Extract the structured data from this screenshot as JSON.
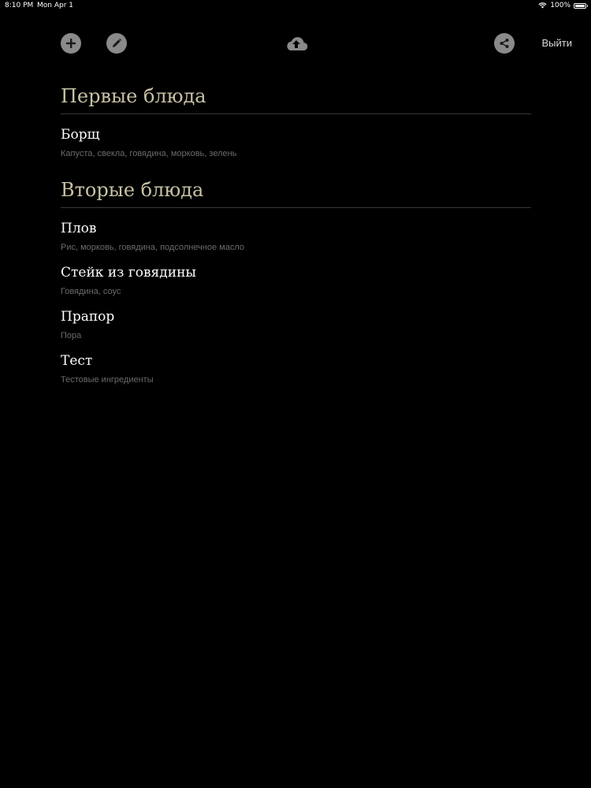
{
  "status_bar": {
    "time": "8:10 PM",
    "date": "Mon Apr 1",
    "battery": "100%",
    "battery_level": 1.0
  },
  "toolbar": {
    "logout_label": "Выйти",
    "icons": [
      "add-icon",
      "edit-icon",
      "cloud-upload-icon",
      "share-icon"
    ],
    "button_color": "#8a8a8a"
  },
  "sections": [
    {
      "title": "Первые блюда",
      "dishes": [
        {
          "name": "Борщ",
          "ingredients": "Капуста, свекла, говядина, морковь, зелень"
        }
      ]
    },
    {
      "title": "Вторые блюда",
      "dishes": [
        {
          "name": "Плов",
          "ingredients": "Рис, морковь, говядина, подсолнечное масло"
        },
        {
          "name": "Стейк из говядины",
          "ingredients": "Говядина, соус"
        },
        {
          "name": "Прапор",
          "ingredients": "Пора"
        },
        {
          "name": "Тест",
          "ingredients": "Тестовые ингредиенты"
        }
      ]
    }
  ],
  "colors": {
    "background": "#000000",
    "section_title": "#c9c2a4",
    "dish_name": "#ffffff",
    "ingredients": "#6b6b6b",
    "divider": "#3a3a3a"
  }
}
